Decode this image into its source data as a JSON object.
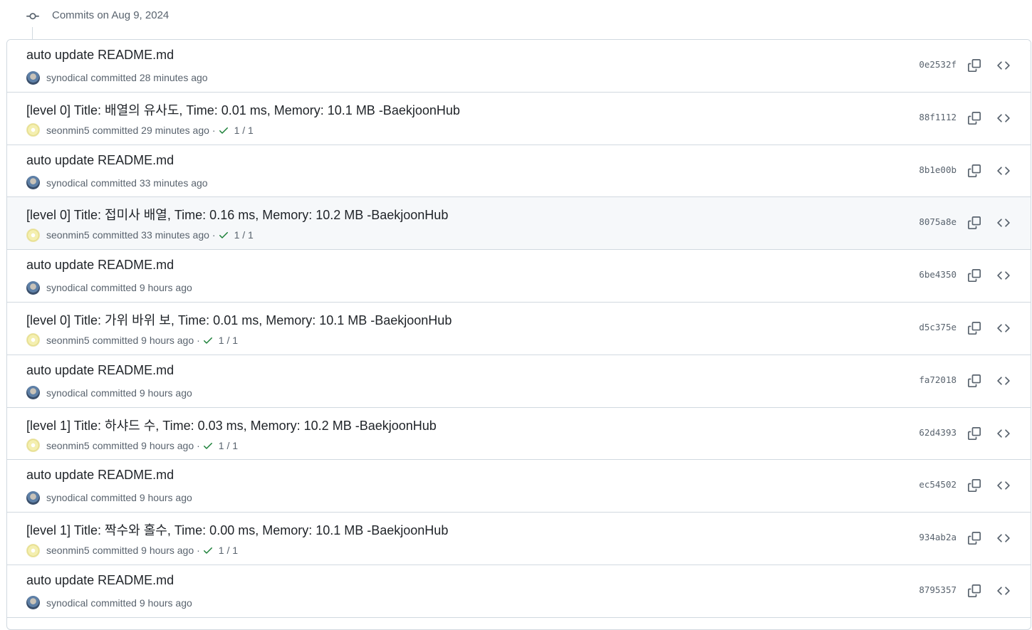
{
  "group": {
    "title": "Commits on Aug 9, 2024"
  },
  "commits": [
    {
      "title": "auto update README.md",
      "author": "synodical",
      "action": "committed",
      "time": "28 minutes ago",
      "sha": "0e2532f",
      "avatar": "synodical",
      "checks": ""
    },
    {
      "title": "[level 0] Title: 배열의 유사도, Time: 0.01 ms, Memory: 10.1 MB -BaekjoonHub",
      "author": "seonmin5",
      "action": "committed",
      "time": "29 minutes ago",
      "sha": "88f1112",
      "avatar": "seonmin5",
      "checks": "1 / 1"
    },
    {
      "title": "auto update README.md",
      "author": "synodical",
      "action": "committed",
      "time": "33 minutes ago",
      "sha": "8b1e00b",
      "avatar": "synodical",
      "checks": ""
    },
    {
      "title": "[level 0] Title: 접미사 배열, Time: 0.16 ms, Memory: 10.2 MB -BaekjoonHub",
      "author": "seonmin5",
      "action": "committed",
      "time": "33 minutes ago",
      "sha": "8075a8e",
      "avatar": "seonmin5",
      "checks": "1 / 1"
    },
    {
      "title": "auto update README.md",
      "author": "synodical",
      "action": "committed",
      "time": "9 hours ago",
      "sha": "6be4350",
      "avatar": "synodical",
      "checks": ""
    },
    {
      "title": "[level 0] Title: 가위 바위 보, Time: 0.01 ms, Memory: 10.1 MB -BaekjoonHub",
      "author": "seonmin5",
      "action": "committed",
      "time": "9 hours ago",
      "sha": "d5c375e",
      "avatar": "seonmin5",
      "checks": "1 / 1"
    },
    {
      "title": "auto update README.md",
      "author": "synodical",
      "action": "committed",
      "time": "9 hours ago",
      "sha": "fa72018",
      "avatar": "synodical",
      "checks": ""
    },
    {
      "title": "[level 1] Title: 하샤드 수, Time: 0.03 ms, Memory: 10.2 MB -BaekjoonHub",
      "author": "seonmin5",
      "action": "committed",
      "time": "9 hours ago",
      "sha": "62d4393",
      "avatar": "seonmin5",
      "checks": "1 / 1"
    },
    {
      "title": "auto update README.md",
      "author": "synodical",
      "action": "committed",
      "time": "9 hours ago",
      "sha": "ec54502",
      "avatar": "synodical",
      "checks": ""
    },
    {
      "title": "[level 1] Title: 짝수와 홀수, Time: 0.00 ms, Memory: 10.1 MB -BaekjoonHub",
      "author": "seonmin5",
      "action": "committed",
      "time": "9 hours ago",
      "sha": "934ab2a",
      "avatar": "seonmin5",
      "checks": "1 / 1"
    },
    {
      "title": "auto update README.md",
      "author": "synodical",
      "action": "committed",
      "time": "9 hours ago",
      "sha": "8795357",
      "avatar": "synodical",
      "checks": ""
    }
  ],
  "colors": {
    "check": "#1a7f37",
    "hover_row": "#f6f8fa",
    "border": "#d1d9e0"
  },
  "icons": {
    "group": "git-commit-icon",
    "copy": "copy-icon",
    "browse": "code-icon",
    "check": "check-icon"
  }
}
